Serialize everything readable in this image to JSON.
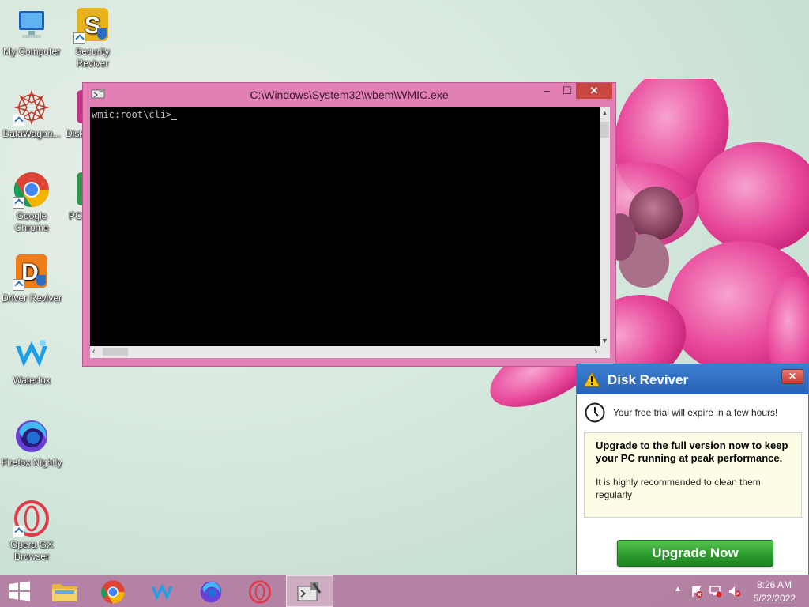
{
  "desktop": {
    "icons": [
      {
        "label": "My Computer"
      },
      {
        "label": "Security Reviver"
      },
      {
        "label": "DataWagon..."
      },
      {
        "label": "Disk"
      },
      {
        "label": "Google Chrome"
      },
      {
        "label": "PC"
      },
      {
        "label": "Driver Reviver"
      },
      {
        "label": "Waterfox"
      },
      {
        "label": "Firefox Nightly"
      },
      {
        "label": "Opera GX Browser"
      }
    ]
  },
  "console_window": {
    "title": "C:\\Windows\\System32\\wbem\\WMIC.exe",
    "prompt": "wmic:root\\cli>",
    "minimize_glyph": "‒",
    "maximize_glyph": "☐",
    "close_glyph": "✕"
  },
  "popup": {
    "title": "Disk Reviver",
    "close_glyph": "✕",
    "trial_text": "Your free trial will expire in a few hours!",
    "headline": "Upgrade to the full version now to keep your PC running at peak performance.",
    "note": "It is highly recommended to clean them regularly",
    "button": "Upgrade Now"
  },
  "taskbar": {
    "apps": [
      "file-explorer",
      "google-chrome",
      "waterfox",
      "firefox-nightly",
      "opera-gx",
      "wmic-console"
    ],
    "time": "8:26 AM",
    "date": "5/22/2022"
  },
  "colors": {
    "window_frame": "#e27fb4",
    "popup_header": "#2a62b5",
    "upgrade_button": "#2b9a2d",
    "close_button": "#c7463d"
  }
}
